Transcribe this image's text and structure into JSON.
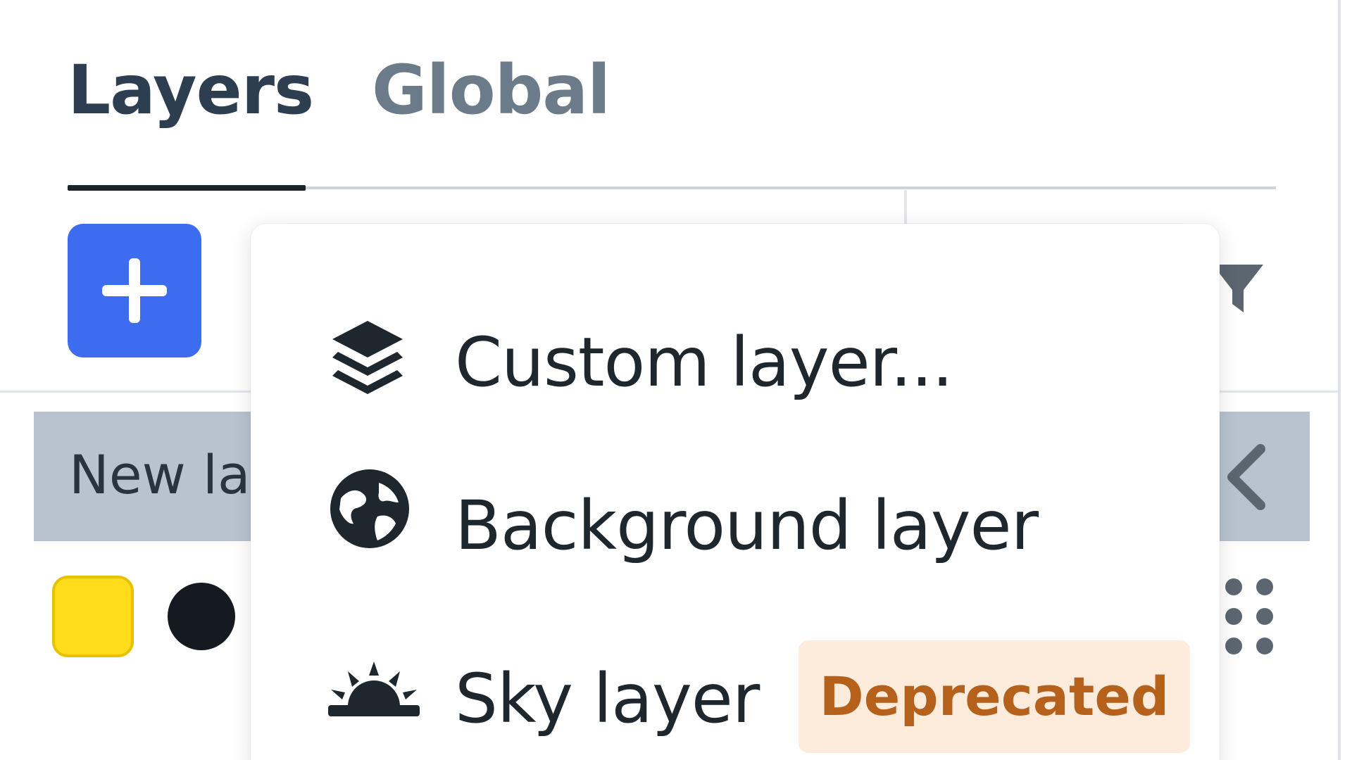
{
  "tabs": [
    {
      "label": "Layers",
      "active": true
    },
    {
      "label": "Global",
      "active": false
    }
  ],
  "toolbar": {
    "add_button_icon": "plus-icon",
    "filter_icon": "filter-icon"
  },
  "layer_list": {
    "row_label": "New lay",
    "swatch_fill_color": "#ffdd1a",
    "swatch_dot_color": "#141a1f"
  },
  "menu": {
    "items": [
      {
        "label": "Custom layer...",
        "icon": "layers-stack-icon"
      },
      {
        "label": "Background layer",
        "icon": "globe-icon"
      },
      {
        "label": "Sky layer",
        "icon": "sunrise-icon",
        "badge": "Deprecated"
      }
    ]
  },
  "colors": {
    "accent": "#3d6cf0",
    "badge_bg": "#fdebdc",
    "badge_text": "#b5611c",
    "row_selected": "#b8c3cf"
  }
}
